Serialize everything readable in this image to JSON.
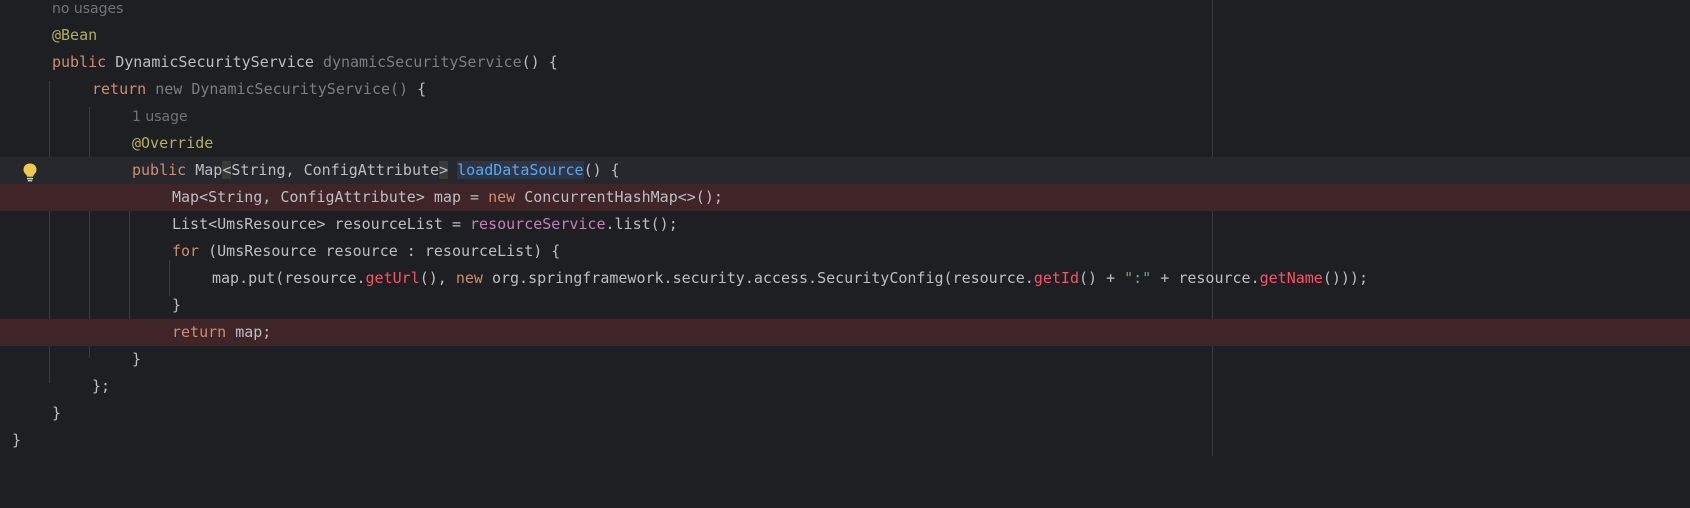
{
  "editor": {
    "inlay_hints": {
      "no_usages": "no usages",
      "one_usage": "1 usage"
    },
    "tokens": {
      "bean_annotation": "@Bean",
      "public": "public",
      "dynamic_security_service_type": "DynamicSecurityService",
      "dynamic_security_service_method": "dynamicSecurityService",
      "parens_open_brace": "() {",
      "return": "return",
      "new": "new",
      "dynamic_security_service_ctor": "DynamicSecurityService()",
      "open_brace": "{",
      "override_annotation": "@Override",
      "map_type": "Map",
      "generic_open": "<",
      "generic_args": "String, ConfigAttribute",
      "generic_close": ">",
      "load_data_source": "loadDataSource",
      "map_decl": "Map<String, ConfigAttribute> map = ",
      "concurrent_hash_map": "ConcurrentHashMap<>();",
      "list_decl": "List<UmsResource> resourceList = ",
      "resource_service": "resourceService",
      "list_call": ".list();",
      "for": "for",
      "for_header": " (UmsResource resource : resourceList) {",
      "map_put_start": "map.put(resource.",
      "get_url": "getUrl",
      "after_get_url": "(), ",
      "security_config": "org.springframework.security.access.SecurityConfig(resource.",
      "get_id": "getId",
      "after_get_id": "() + ",
      "colon_string": "\":\"",
      "plus_resource": " + resource.",
      "get_name": "getName",
      "end_put": "()));",
      "close_brace": "}",
      "return_map": "map;",
      "close_brace_semicolon": "};"
    }
  },
  "colors": {
    "background": "#1e1f22",
    "keyword": "#cf8e6d",
    "annotation": "#b3ae60",
    "function_decl": "#56a8f5",
    "field": "#c77dbb",
    "method_call": "#f75464",
    "string": "#6aab73",
    "breakpoint_line": "#3f2528",
    "intention_bulb": "#f2c94c"
  },
  "icons": {
    "gutter": "lightbulb-icon"
  }
}
